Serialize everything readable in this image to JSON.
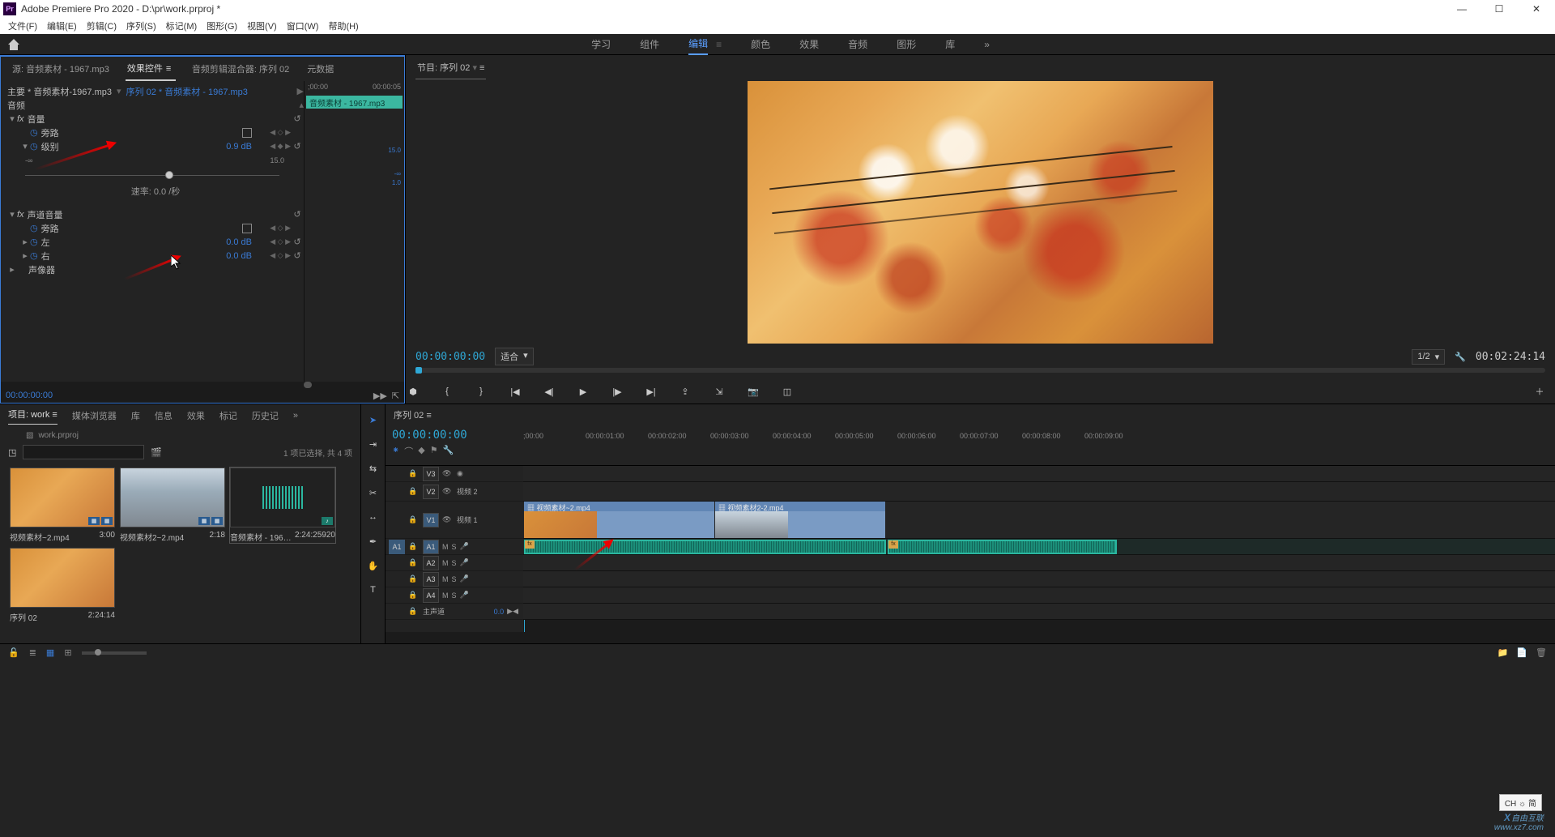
{
  "titlebar": {
    "app": "Adobe Premiere Pro 2020",
    "sep": " - ",
    "path": "D:\\pr\\work.prproj *"
  },
  "menubar": [
    "文件(F)",
    "编辑(E)",
    "剪辑(C)",
    "序列(S)",
    "标记(M)",
    "图形(G)",
    "视图(V)",
    "窗口(W)",
    "帮助(H)"
  ],
  "workspaces": {
    "items": [
      "学习",
      "组件",
      "编辑",
      "颜色",
      "效果",
      "音频",
      "图形",
      "库"
    ],
    "active": 2,
    "overflow": "»"
  },
  "source": {
    "tabs": {
      "source": "源: 音频素材 - 1967.mp3",
      "effect": "效果控件",
      "mixer": "音频剪辑混合器: 序列 02",
      "meta": "元数据",
      "active": 1
    },
    "master_clip": "主要 * 音频素材-1967.mp3",
    "sequence_clip": "序列 02 * 音频素材 - 1967.mp3",
    "timeruler": {
      "start": ";00:00",
      "end": "00:00:05"
    },
    "clip_bar": "音频素材 - 1967.mp3",
    "sections": {
      "audio": "音频",
      "volume": {
        "label": "音量",
        "bypass": "旁路",
        "level": "级别",
        "level_val": "0.9 dB",
        "slider_min": "-∞",
        "slider_max": "15.0",
        "slider_right_top": "15.0",
        "slider_right_mid": "-∞",
        "slider_right_bot": "1.0",
        "rate": "速率: 0.0 /秒"
      },
      "channel": {
        "label": "声道音量",
        "bypass": "旁路",
        "left": "左",
        "left_val": "0.0 dB",
        "right": "右",
        "right_val": "0.0 dB"
      },
      "panner": "声像器"
    },
    "footer_tc": "00:00:00:00"
  },
  "program": {
    "tab": "节目: 序列 02",
    "tc_left": "00:00:00:00",
    "fit": "适合",
    "zoom": "1/2",
    "tc_right": "00:02:24:14"
  },
  "project": {
    "tabs": [
      "项目: work",
      "媒体浏览器",
      "库",
      "信息",
      "效果",
      "标记",
      "历史记"
    ],
    "active": 0,
    "overflow": "»",
    "path": "work.prproj",
    "status": "1 项已选择, 共 4 项",
    "items": [
      {
        "name": "视频素材~2.mp4",
        "dur": "3:00",
        "thumb": "vid1"
      },
      {
        "name": "视频素材2~2.mp4",
        "dur": "2:18",
        "thumb": "vid2"
      },
      {
        "name": "音频素材 - 196…",
        "dur": "2:24:25920",
        "thumb": "audio"
      },
      {
        "name": "序列 02",
        "dur": "2:24:14",
        "thumb": "vid1"
      }
    ]
  },
  "timeline": {
    "tab": "序列 02",
    "tc": "00:00:00:00",
    "ruler": [
      ";00:00",
      "00:00:01:00",
      "00:00:02:00",
      "00:00:03:00",
      "00:00:04:00",
      "00:00:05:00",
      "00:00:06:00",
      "00:00:07:00",
      "00:00:08:00",
      "00:00:09:00"
    ],
    "tracks": {
      "v3": {
        "patch": "V3",
        "name": ""
      },
      "v2": {
        "patch": "V2",
        "name": "视频 2"
      },
      "v1": {
        "patch": "V1",
        "name": "视频 1"
      },
      "a1": {
        "src": "A1",
        "patch": "A1"
      },
      "a2": {
        "patch": "A2"
      },
      "a3": {
        "patch": "A3"
      },
      "a4": {
        "patch": "A4"
      },
      "master": {
        "name": "主声道",
        "val": "0.0"
      }
    },
    "ms": {
      "m": "M",
      "s": "S"
    },
    "clips": {
      "v1a": "视频素材~2.mp4",
      "v1b": "视频素材2-2.mp4"
    }
  },
  "ime": "CH ☼ 简",
  "watermark": {
    "brand": "自由互联",
    "url": "www.xz7.com"
  }
}
